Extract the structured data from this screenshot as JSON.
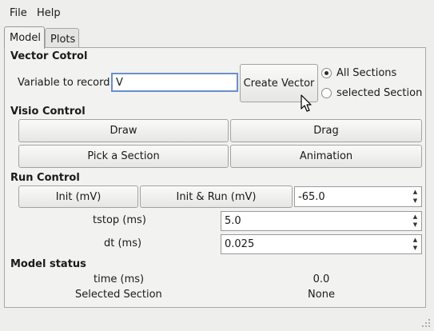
{
  "menubar": {
    "file": "File",
    "help": "Help"
  },
  "tabs": [
    {
      "label": "Model",
      "active": true
    },
    {
      "label": "Plots",
      "active": false
    }
  ],
  "vector_control": {
    "title": "Vector Cotrol",
    "variable_label": "Variable to record:",
    "variable_value": "V",
    "create_button": "Create Vector",
    "radio_all": "All Sections",
    "radio_selected": "selected Section",
    "selected_option": "All Sections"
  },
  "visio_control": {
    "title": "Visio Control",
    "draw": "Draw",
    "drag": "Drag",
    "pick": "Pick a Section",
    "animation": "Animation"
  },
  "run_control": {
    "title": "Run Control",
    "init": "Init (mV)",
    "init_run": "Init & Run (mV)",
    "init_value": "-65.0",
    "tstop_label": "tstop (ms)",
    "tstop_value": "5.0",
    "dt_label": "dt (ms)",
    "dt_value": "0.025"
  },
  "model_status": {
    "title": "Model status",
    "time_label": "time (ms)",
    "time_value": "0.0",
    "section_label": "Selected Section",
    "section_value": "None"
  },
  "icons": [
    "mouse-pointer-icon",
    "resize-grip-icon",
    "spin-up-icon",
    "spin-down-icon"
  ]
}
